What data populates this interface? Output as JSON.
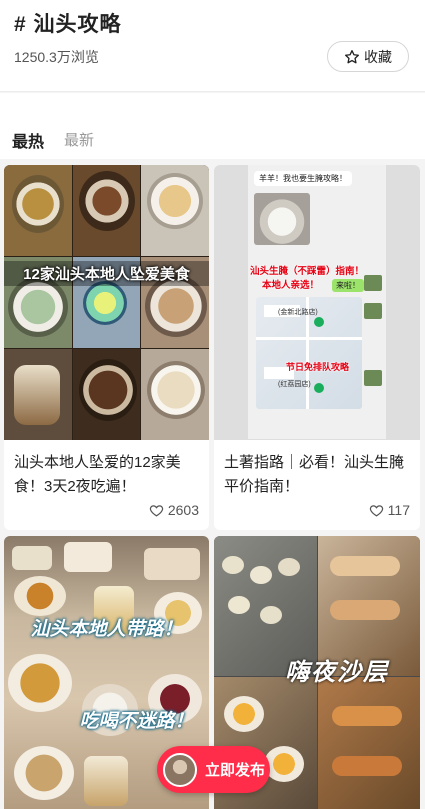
{
  "header": {
    "title": "# 汕头攻略",
    "views": "1250.3万浏览",
    "collect_label": "收藏"
  },
  "tabs": [
    {
      "label": "最热",
      "active": true
    },
    {
      "label": "最新",
      "active": false
    }
  ],
  "cards": [
    {
      "title": "汕头本地人坠爱的12家美食！3天2夜吃遍！",
      "likes": "2603",
      "overlay": "12家汕头本地人坠爱美食"
    },
    {
      "title": "土著指路｜必看！汕头生腌平价指南！",
      "likes": "117",
      "chat": {
        "bubble_top": "羊羊！我也要生腌攻略！",
        "red_line1": "汕头生腌（不踩雷）指南！",
        "red_line2": "本地人亲选！",
        "reply": "来啦！",
        "map_label1": "(金新北路店)",
        "map_label2": "(红荔园店)",
        "red_line3": "节日免排队攻略"
      }
    },
    {
      "overlay1": "汕头本地人带路！",
      "overlay2": "吃喝不迷路！"
    },
    {
      "overlay": "嗨夜沙层"
    }
  ],
  "publish": {
    "label": "立即发布"
  }
}
